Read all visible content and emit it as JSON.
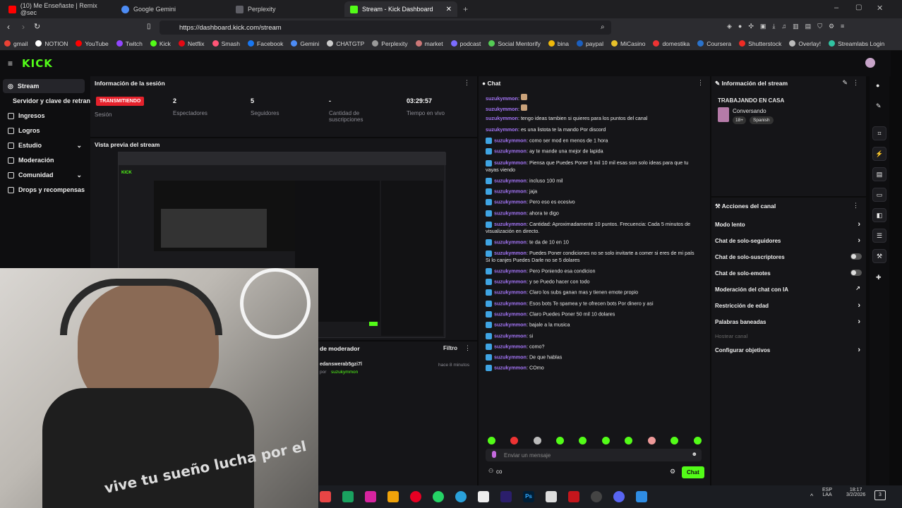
{
  "browser": {
    "tabs": [
      {
        "label": "(10) Me Enseñaste | Remix @sec",
        "icon": "youtube-icon",
        "color": "#ff0000"
      },
      {
        "label": "Google Gemini",
        "icon": "gemini-icon",
        "color": "#4d8cf5"
      },
      {
        "label": "Perplexity",
        "icon": "perplexity-icon",
        "color": "#5f5f66"
      },
      {
        "label": "Stream - Kick Dashboard",
        "icon": "kick-icon",
        "color": "#53fc18",
        "active": true
      }
    ],
    "url": "https://dashboard.kick.com/stream",
    "bookmarks": [
      "gmail",
      "NOTION",
      "YouTube",
      "Twitch",
      "Kick",
      "Netflix",
      "Smash",
      "Facebook",
      "Gemini",
      "CHATGTP",
      "Perplexity",
      "market",
      "podcast",
      "Social Mentorify",
      "bina",
      "paypal",
      "MiCasino",
      "domestika",
      "Coursera",
      "Shutterstock",
      "Overlay!",
      "Streamlabs Login"
    ]
  },
  "app": {
    "logo": "KICK"
  },
  "sidebar": {
    "items": [
      {
        "label": "Stream",
        "icon": "stream-icon"
      },
      {
        "label": "Servidor y clave de retransmisión",
        "icon": ""
      },
      {
        "label": "Ingresos",
        "icon": "income-icon"
      },
      {
        "label": "Logros",
        "icon": "achievements-icon"
      },
      {
        "label": "Estudio",
        "icon": "studio-icon",
        "chevron": true
      },
      {
        "label": "Moderación",
        "icon": "moderation-icon"
      },
      {
        "label": "Comunidad",
        "icon": "community-icon",
        "chevron": true
      },
      {
        "label": "Drops y recompensas",
        "icon": "drops-icon"
      }
    ]
  },
  "session": {
    "title": "Información de la sesión",
    "live_badge": "TRANSMITIENDO",
    "live_label": "Sesión",
    "stats": [
      {
        "value": "2",
        "label": "Espectadores"
      },
      {
        "value": "5",
        "label": "Seguidores"
      },
      {
        "value": "-",
        "label": "Cantidad de suscripciones"
      },
      {
        "value": "03:29:57",
        "label": "Tiempo en vivo"
      }
    ]
  },
  "preview": {
    "title": "Vista previa del stream"
  },
  "modlog": {
    "title": "de moderador",
    "filter": "Filtro",
    "entry_user": "edanswerab5gzi7l",
    "entry_sub": "por",
    "entry_by": "suzukymmon",
    "entry_time": "hace 8 minutos"
  },
  "chat": {
    "title": "Chat",
    "input_placeholder": "Enviar un mensaje",
    "send_label": "Chat",
    "footer_count": "co",
    "messages": [
      {
        "user": "suzukymmon",
        "text": "",
        "badge": false
      },
      {
        "user": "suzukymmon",
        "text": "",
        "badge": false
      },
      {
        "user": "suzukymmon",
        "text": "tengo ideas tambien si quieres para los puntos del canal",
        "badge": false
      },
      {
        "user": "suzukymmon",
        "text": "es una listota te la mando Por discord",
        "badge": false
      },
      {
        "user": "suzukymmon",
        "text": "como ser mod en menos de 1 hora",
        "badge": true
      },
      {
        "user": "suzukymmon",
        "text": "ay te mande una mejor de lapida",
        "badge": true
      },
      {
        "user": "suzukymmon",
        "text": "Piensa que Puedes Poner 5 mil 10 mil esas son solo ideas para que tu vayas viendo",
        "badge": true
      },
      {
        "user": "suzukymmon",
        "text": "incluso 100 mil",
        "badge": true
      },
      {
        "user": "suzukymmon",
        "text": "jaja",
        "badge": true
      },
      {
        "user": "suzukymmon",
        "text": "Pero eso es ecesivo",
        "badge": true
      },
      {
        "user": "suzukymmon",
        "text": "ahora te digo",
        "badge": true
      },
      {
        "user": "suzukymmon",
        "text": "Cantidad: Aproximadamente 10 puntos. Frecuencia: Cada 5 minutos de visualización en directo.",
        "badge": true
      },
      {
        "user": "suzukymmon",
        "text": "te da de 10 en 10",
        "badge": true
      },
      {
        "user": "suzukymmon",
        "text": "Puedes Poner condiciones no se solo invitarte a comer si eres de mi país Si lo canjes Puedes Darle no se 5 dolares",
        "badge": true
      },
      {
        "user": "suzukymmon",
        "text": "Pero Poniendo esa condicion",
        "badge": true
      },
      {
        "user": "suzukymmon",
        "text": "y se Puedo hacer con todo",
        "badge": true
      },
      {
        "user": "suzukymmon",
        "text": "Claro los subs ganan mas y tienen emote propio",
        "badge": true
      },
      {
        "user": "suzukymmon",
        "text": "Esos bots Te spamea y te ofrecen bots Por dinero y asi",
        "badge": true
      },
      {
        "user": "suzukymmon",
        "text": "Claro Puedes Poner 50 mil 10 dolares",
        "badge": true
      },
      {
        "user": "suzukymmon",
        "text": "bajale a la musica",
        "badge": true
      },
      {
        "user": "suzukymmon",
        "text": "si",
        "badge": true
      },
      {
        "user": "suzukymmon",
        "text": "como?",
        "badge": true
      },
      {
        "user": "suzukymmon",
        "text": "De que hablas",
        "badge": true
      },
      {
        "user": "suzukymmon",
        "text": "COmo",
        "badge": true
      }
    ]
  },
  "stream_info": {
    "title": "Información del stream",
    "stream_title": "TRABAJANDO EN CASA",
    "category": "Conversando",
    "tags": [
      "18+",
      "Spanish"
    ]
  },
  "channel_actions": {
    "title": "Acciones del canal",
    "items": [
      {
        "label": "Modo lento",
        "control": "chevron"
      },
      {
        "label": "Chat de solo-seguidores",
        "control": "chevron"
      },
      {
        "label": "Chat de solo-suscriptores",
        "control": "toggle"
      },
      {
        "label": "Chat de solo-emotes",
        "control": "toggle"
      },
      {
        "label": "Moderación del chat con IA",
        "control": "link"
      },
      {
        "label": "Restricción de edad",
        "control": "chevron"
      },
      {
        "label": "Palabras baneadas",
        "control": "chevron"
      },
      {
        "label": "Hostear canal",
        "control": "none",
        "disabled": true
      },
      {
        "label": "Configurar objetivos",
        "control": "chevron"
      }
    ]
  },
  "webcam_caption": "vive tu sueño lucha por el",
  "taskbar": {
    "lang": "ESP",
    "region": "LAA",
    "time": "18:17",
    "date": "3/2/2026",
    "notif": "3"
  }
}
